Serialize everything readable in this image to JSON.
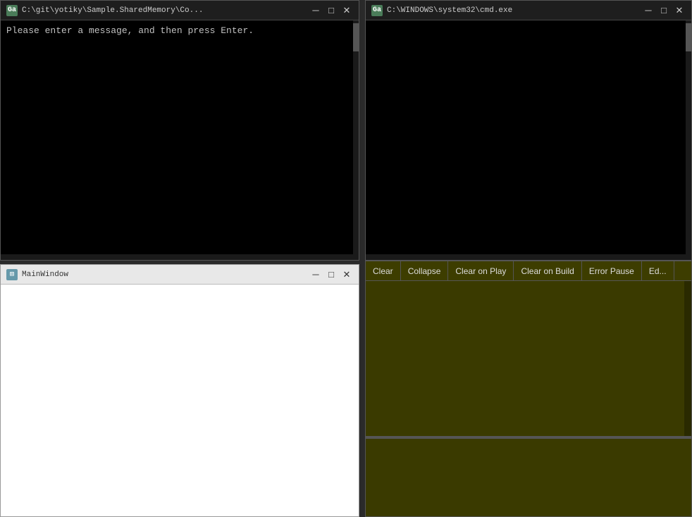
{
  "windows": {
    "terminal_left": {
      "icon": "Ga",
      "title": "C:\\git\\yotiky\\Sample.SharedMemory\\Co...",
      "content": "Please enter a message, and then press Enter.",
      "min_label": "─",
      "max_label": "□",
      "close_label": "✕"
    },
    "terminal_right": {
      "icon": "Ga",
      "title": "C:\\WINDOWS\\system32\\cmd.exe",
      "min_label": "─",
      "max_label": "□",
      "close_label": "✕"
    },
    "main_window": {
      "icon": "⊞",
      "title": "MainWindow",
      "min_label": "─",
      "max_label": "□",
      "close_label": "✕"
    },
    "console": {
      "toolbar": {
        "clear_label": "Clear",
        "collapse_label": "Collapse",
        "clear_on_play_label": "Clear on Play",
        "clear_on_build_label": "Clear on Build",
        "error_pause_label": "Error Pause",
        "editor_label": "Ed..."
      }
    }
  }
}
